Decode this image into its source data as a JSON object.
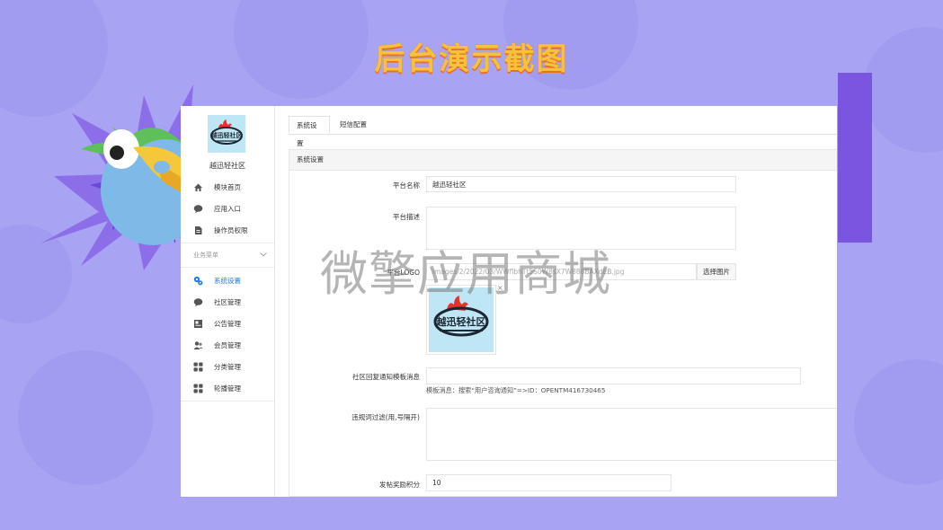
{
  "banner": {
    "title": "后台演示截图"
  },
  "watermark": "微擎应用商城",
  "colors": {
    "background": "#a9a3f3",
    "accent_bar": "#7b55e0",
    "active_nav": "#2a7be4",
    "title_fill": "#f6c23a",
    "title_stroke": "#e96e2a"
  },
  "sidebar": {
    "logo_text": "越迅轻社区",
    "site_name": "越迅轻社区",
    "top_items": [
      {
        "label": "模块首页",
        "icon": "home-icon"
      },
      {
        "label": "应用入口",
        "icon": "chat-bubble-icon"
      },
      {
        "label": "操作员权限",
        "icon": "document-icon"
      }
    ],
    "section_label": "业务菜单",
    "section_icon": "chevron-down-icon",
    "business_items": [
      {
        "label": "系统设置",
        "icon": "gears-icon",
        "active": true
      },
      {
        "label": "社区管理",
        "icon": "chat-bubble-icon"
      },
      {
        "label": "公告管理",
        "icon": "notice-icon"
      },
      {
        "label": "会员管理",
        "icon": "users-icon"
      },
      {
        "label": "分类管理",
        "icon": "grid-icon"
      },
      {
        "label": "轮播管理",
        "icon": "grid-icon"
      }
    ]
  },
  "tabs": [
    {
      "label": "系统设置",
      "active": true
    },
    {
      "label": "短信配置",
      "active": false
    }
  ],
  "panel": {
    "title": "系统设置",
    "platform_name": {
      "label": "平台名称",
      "value": "越迅轻社区"
    },
    "platform_desc": {
      "label": "平台描述",
      "value": ""
    },
    "platform_logo": {
      "label": "平台LOGO",
      "value": "images/2/2022/03/WWflbhTt5S0W8sX7W888BAXdEB.jpg",
      "button": "选择图片",
      "preview_text": "越迅轻社区",
      "close": "×"
    },
    "reply_notice": {
      "label": "社区回复通知模板消息",
      "value": "",
      "hint": "模板消息：搜索“用户咨询通知”=>ID：OPENTM416730465"
    },
    "word_filter": {
      "label": "违规词过滤(用,号隔开)",
      "value": ""
    },
    "post_points": {
      "label": "发帖奖励积分",
      "value": "10"
    }
  }
}
